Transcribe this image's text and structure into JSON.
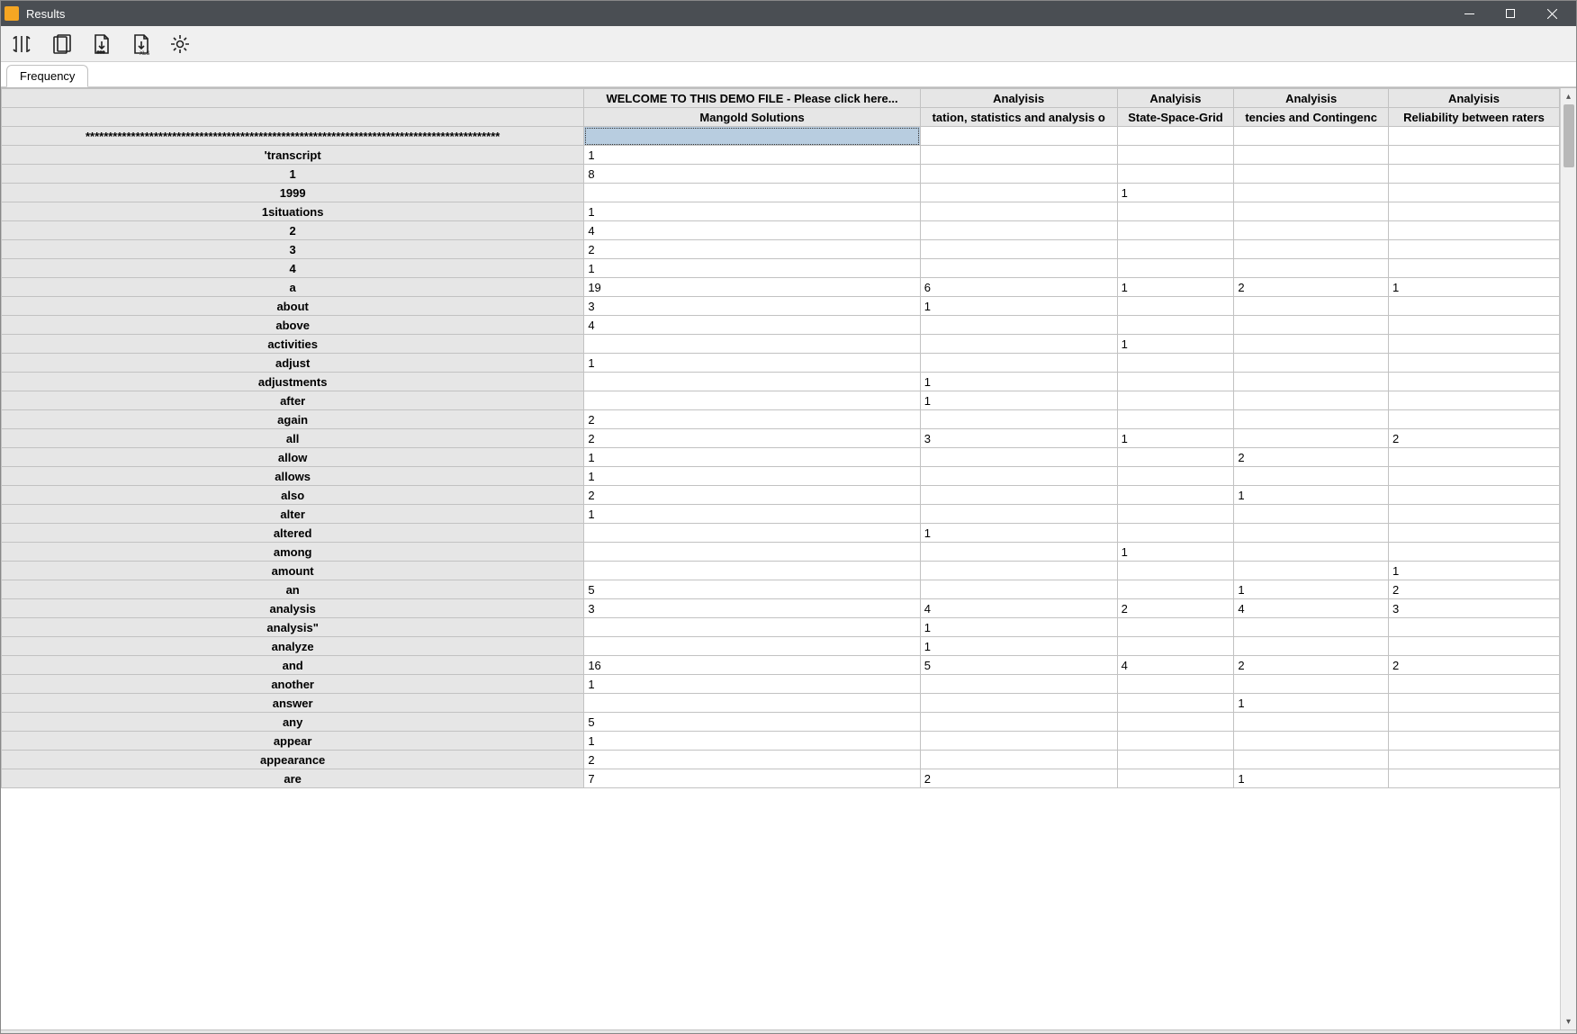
{
  "window": {
    "title": "Results"
  },
  "toolbar": {
    "icons": [
      "columns-icon",
      "copy-icon",
      "export-icon",
      "export-xls-icon",
      "settings-icon"
    ]
  },
  "tabs": [
    {
      "label": "Frequency"
    }
  ],
  "grid": {
    "columns": [
      "",
      "WELCOME TO THIS DEMO FILE - Please click here...",
      "Analyisis",
      "Analyisis",
      "Analyisis",
      "Analyisis"
    ],
    "subcolumns": [
      "",
      "Mangold Solutions",
      "tation, statistics and analysis o",
      "State-Space-Grid",
      "tencies and Contingenc",
      "Reliability between raters"
    ],
    "selected_cell": {
      "row": 0,
      "col": 1
    },
    "rows": [
      {
        "label": "*******************************************************************************************",
        "cells": [
          "",
          "",
          "",
          "",
          ""
        ]
      },
      {
        "label": "'transcript",
        "cells": [
          "1",
          "",
          "",
          "",
          ""
        ]
      },
      {
        "label": "1",
        "cells": [
          "8",
          "",
          "",
          "",
          ""
        ]
      },
      {
        "label": "1999",
        "cells": [
          "",
          "",
          "1",
          "",
          ""
        ]
      },
      {
        "label": "1situations",
        "cells": [
          "1",
          "",
          "",
          "",
          ""
        ]
      },
      {
        "label": "2",
        "cells": [
          "4",
          "",
          "",
          "",
          ""
        ]
      },
      {
        "label": "3",
        "cells": [
          "2",
          "",
          "",
          "",
          ""
        ]
      },
      {
        "label": "4",
        "cells": [
          "1",
          "",
          "",
          "",
          ""
        ]
      },
      {
        "label": "a",
        "cells": [
          "19",
          "6",
          "1",
          "2",
          "1"
        ]
      },
      {
        "label": "about",
        "cells": [
          "3",
          "1",
          "",
          "",
          ""
        ]
      },
      {
        "label": "above",
        "cells": [
          "4",
          "",
          "",
          "",
          ""
        ]
      },
      {
        "label": "activities",
        "cells": [
          "",
          "",
          "1",
          "",
          ""
        ]
      },
      {
        "label": "adjust",
        "cells": [
          "1",
          "",
          "",
          "",
          ""
        ]
      },
      {
        "label": "adjustments",
        "cells": [
          "",
          "1",
          "",
          "",
          ""
        ]
      },
      {
        "label": "after",
        "cells": [
          "",
          "1",
          "",
          "",
          ""
        ]
      },
      {
        "label": "again",
        "cells": [
          "2",
          "",
          "",
          "",
          ""
        ]
      },
      {
        "label": "all",
        "cells": [
          "2",
          "3",
          "1",
          "",
          "2"
        ]
      },
      {
        "label": "allow",
        "cells": [
          "1",
          "",
          "",
          "2",
          ""
        ]
      },
      {
        "label": "allows",
        "cells": [
          "1",
          "",
          "",
          "",
          ""
        ]
      },
      {
        "label": "also",
        "cells": [
          "2",
          "",
          "",
          "1",
          ""
        ]
      },
      {
        "label": "alter",
        "cells": [
          "1",
          "",
          "",
          "",
          ""
        ]
      },
      {
        "label": "altered",
        "cells": [
          "",
          "1",
          "",
          "",
          ""
        ]
      },
      {
        "label": "among",
        "cells": [
          "",
          "",
          "1",
          "",
          ""
        ]
      },
      {
        "label": "amount",
        "cells": [
          "",
          "",
          "",
          "",
          "1"
        ]
      },
      {
        "label": "an",
        "cells": [
          "5",
          "",
          "",
          "1",
          "2"
        ]
      },
      {
        "label": "analysis",
        "cells": [
          "3",
          "4",
          "2",
          "4",
          "3"
        ]
      },
      {
        "label": "analysis\"",
        "cells": [
          "",
          "1",
          "",
          "",
          ""
        ]
      },
      {
        "label": "analyze",
        "cells": [
          "",
          "1",
          "",
          "",
          ""
        ]
      },
      {
        "label": "and",
        "cells": [
          "16",
          "5",
          "4",
          "2",
          "2"
        ]
      },
      {
        "label": "another",
        "cells": [
          "1",
          "",
          "",
          "",
          ""
        ]
      },
      {
        "label": "answer",
        "cells": [
          "",
          "",
          "",
          "1",
          ""
        ]
      },
      {
        "label": "any",
        "cells": [
          "5",
          "",
          "",
          "",
          ""
        ]
      },
      {
        "label": "appear",
        "cells": [
          "1",
          "",
          "",
          "",
          ""
        ]
      },
      {
        "label": "appearance",
        "cells": [
          "2",
          "",
          "",
          "",
          ""
        ]
      },
      {
        "label": "are",
        "cells": [
          "7",
          "2",
          "",
          "1",
          ""
        ]
      }
    ]
  }
}
